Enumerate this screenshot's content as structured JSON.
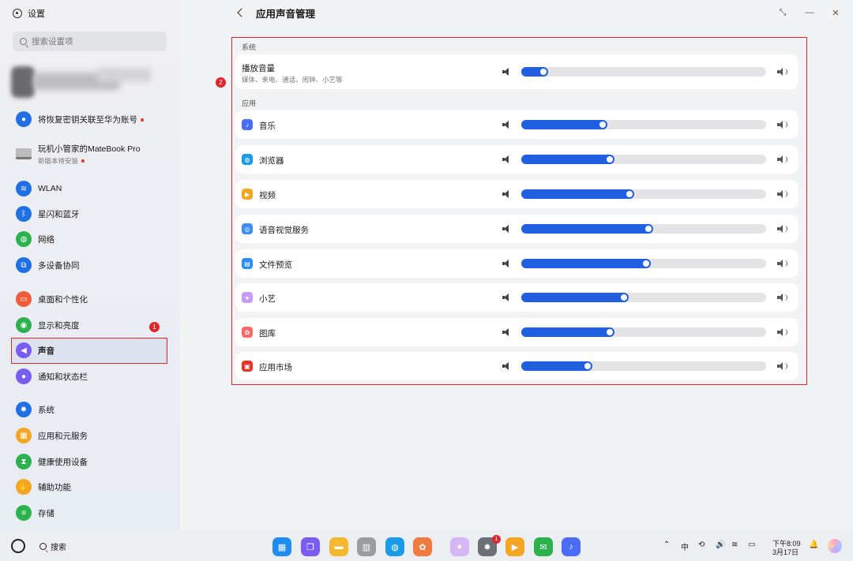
{
  "app": {
    "title": "设置"
  },
  "search": {
    "placeholder": "搜索设置项"
  },
  "sidebar": {
    "notices": [
      {
        "label": "将恢复密钥关联至华为账号"
      },
      {
        "label": "玩机小管家的MateBook Pro",
        "sub": "新版本待安装"
      }
    ],
    "items": [
      {
        "label": "WLAN",
        "icon": "wifi-icon",
        "color": "#1f6fe5"
      },
      {
        "label": "星闪和蓝牙",
        "icon": "bluetooth-icon",
        "color": "#1f6fe5"
      },
      {
        "label": "网络",
        "icon": "globe-icon",
        "color": "#2bb24c"
      },
      {
        "label": "多设备协同",
        "icon": "devices-icon",
        "color": "#1f6fe5"
      },
      {
        "label": "桌面和个性化",
        "icon": "desktop-icon",
        "color": "#f25c3b"
      },
      {
        "label": "显示和亮度",
        "icon": "eye-icon",
        "color": "#2bb24c"
      },
      {
        "label": "声音",
        "icon": "speaker-icon",
        "color": "#7a5cf0"
      },
      {
        "label": "通知和状态栏",
        "icon": "bell-icon",
        "color": "#7a5cf0"
      },
      {
        "label": "系统",
        "icon": "gear-icon",
        "color": "#1f6fe5"
      },
      {
        "label": "应用和元服务",
        "icon": "apps-icon",
        "color": "#f5a524"
      },
      {
        "label": "健康使用设备",
        "icon": "hourglass-icon",
        "color": "#2bb24c"
      },
      {
        "label": "辅助功能",
        "icon": "hand-icon",
        "color": "#f5a524"
      },
      {
        "label": "存储",
        "icon": "storage-icon",
        "color": "#2bb24c"
      }
    ],
    "active": "声音"
  },
  "markers": {
    "one": "1",
    "two": "2"
  },
  "page": {
    "title": "应用声音管理"
  },
  "system_section": {
    "label": "系统",
    "row": {
      "name": "播放音量",
      "desc": "媒体、来电、通话、闹钟、小艺等",
      "level": 0.11
    }
  },
  "apps_section": {
    "label": "应用",
    "rows": [
      {
        "name": "音乐",
        "icon": "music-icon",
        "color": "#4a6cf7",
        "level": 0.35
      },
      {
        "name": "浏览器",
        "icon": "browser-icon",
        "color": "#1a9be8",
        "level": 0.38
      },
      {
        "name": "视频",
        "icon": "video-icon",
        "color": "#f5a524",
        "level": 0.46
      },
      {
        "name": "语音视觉服务",
        "icon": "voice-vision-icon",
        "color": "#3d8ef0",
        "level": 0.54
      },
      {
        "name": "文件预览",
        "icon": "file-preview-icon",
        "color": "#2d8cf0",
        "level": 0.53
      },
      {
        "name": "小艺",
        "icon": "xiaoyi-icon",
        "color": "#c89bf5",
        "level": 0.44
      },
      {
        "name": "图库",
        "icon": "gallery-icon",
        "color": "#ff6b6b",
        "level": 0.38
      },
      {
        "name": "应用市场",
        "icon": "appstore-icon",
        "color": "#e6332a",
        "level": 0.29
      }
    ]
  },
  "taskbar": {
    "search_label": "搜索",
    "dock": [
      {
        "icon": "launcher-icon",
        "color": "#1f8cf0"
      },
      {
        "icon": "multitask-icon",
        "color": "#7a5cf0"
      },
      {
        "icon": "files-icon",
        "color": "#f5b82e"
      },
      {
        "icon": "trash-icon",
        "color": "#9a9ca0"
      },
      {
        "icon": "browser-icon",
        "color": "#1a9be8"
      },
      {
        "icon": "gallery-icon",
        "color": "#f07b3f"
      },
      {
        "icon": "xiaoyi-icon",
        "color": "#d6b7f5"
      },
      {
        "icon": "settings-icon",
        "color": "#6b6f76"
      },
      {
        "icon": "video-icon",
        "color": "#f5a524"
      },
      {
        "icon": "messages-icon",
        "color": "#2bb24c"
      },
      {
        "icon": "music-icon",
        "color": "#4a6cf7"
      }
    ],
    "settings_badge": "1",
    "clock_time": "下午8:09",
    "clock_date": "3月17日"
  },
  "colors": {
    "accent": "#1f5fe0",
    "highlight": "#e0262a"
  }
}
